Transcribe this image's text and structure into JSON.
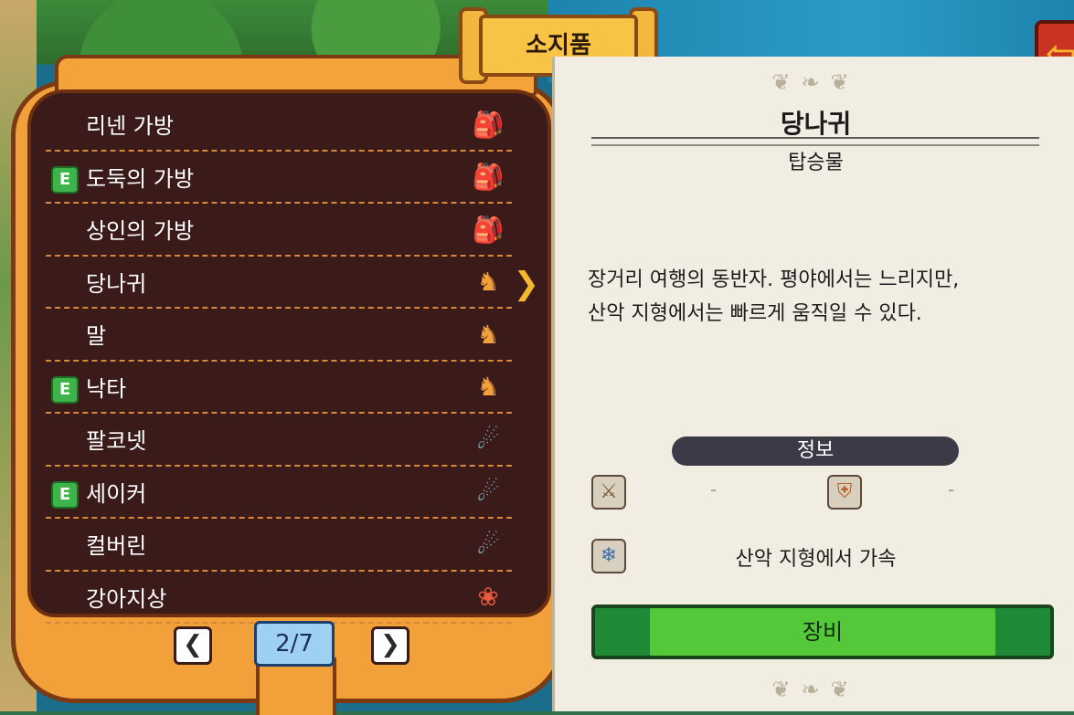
{
  "header": {
    "title": "소지품"
  },
  "back_button": {
    "icon": "arrow-left-icon"
  },
  "inventory": {
    "items": [
      {
        "label": "리넨 가방",
        "equipped": false,
        "icon": "bag-icon"
      },
      {
        "label": "도둑의 가방",
        "equipped": true,
        "icon": "bag-icon"
      },
      {
        "label": "상인의 가방",
        "equipped": false,
        "icon": "bag-icon"
      },
      {
        "label": "당나귀",
        "equipped": false,
        "icon": "horse-icon",
        "selected": true
      },
      {
        "label": "말",
        "equipped": false,
        "icon": "horse-icon"
      },
      {
        "label": "낙타",
        "equipped": true,
        "icon": "horse-icon"
      },
      {
        "label": "팔코넷",
        "equipped": false,
        "icon": "cannon-icon"
      },
      {
        "label": "세이커",
        "equipped": true,
        "icon": "cannon-icon"
      },
      {
        "label": "컬버린",
        "equipped": false,
        "icon": "cannon-icon"
      },
      {
        "label": "강아지상",
        "equipped": false,
        "icon": "figurehead-icon"
      }
    ],
    "equipped_badge": "E",
    "pager": {
      "label": "2/7"
    }
  },
  "detail": {
    "name": "당나귀",
    "category": "탑승물",
    "description_line1": "장거리 여행의 동반자. 평야에서는 느리지만,",
    "description_line2": "산악 지형에서는 빠르게 움직일 수 있다.",
    "info_header": "정보",
    "attack_value": "-",
    "defense_value": "-",
    "ability": "산악 지형에서 가속",
    "equip_label": "장비"
  }
}
